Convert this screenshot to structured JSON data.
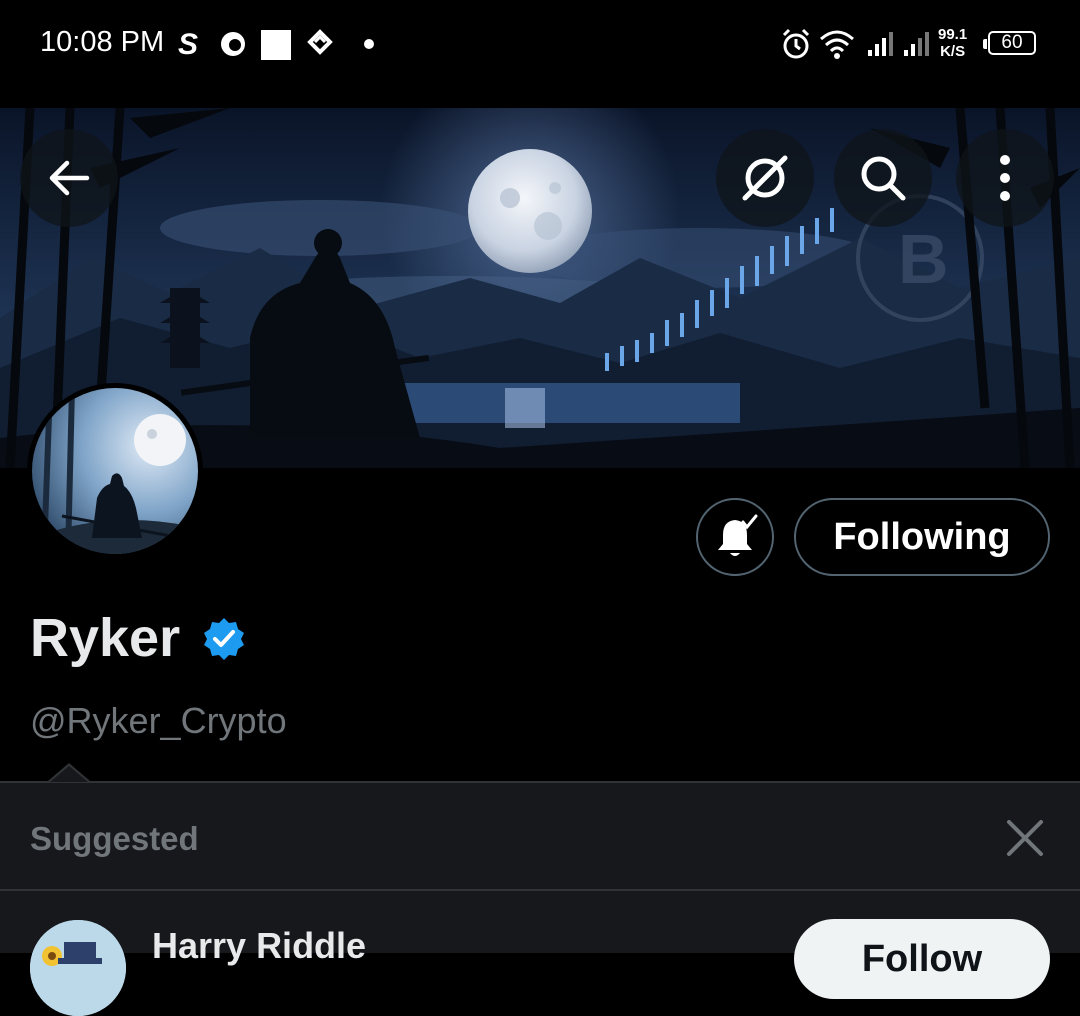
{
  "status_bar": {
    "time": "10:08 PM",
    "net_speed_value": "99.1",
    "net_speed_unit": "K/S",
    "battery": "60",
    "icons": [
      "s-app-icon",
      "vpn-icon",
      "white-square-icon",
      "binance-icon",
      "dot-icon",
      "alarm-icon",
      "wifi-icon",
      "signal-1-icon",
      "signal-2-icon"
    ]
  },
  "header": {
    "back_icon": "arrow-left-icon",
    "grok_icon": "grok-icon",
    "search_icon": "search-icon",
    "more_icon": "more-vertical-icon"
  },
  "profile": {
    "name": "Ryker",
    "handle": "@Ryker_Crypto",
    "verified": true,
    "verified_color": "#1d9bf0",
    "notify_icon": "bell-check-icon",
    "following_label": "Following"
  },
  "suggested": {
    "title": "Suggested",
    "close_icon": "close-icon",
    "items": [
      {
        "name": "Harry Riddle",
        "follow_label": "Follow"
      }
    ]
  },
  "colors": {
    "background": "#000000",
    "panel": "#16181c",
    "border": "#536471",
    "muted_text": "#71767b",
    "accent": "#1d9bf0"
  }
}
